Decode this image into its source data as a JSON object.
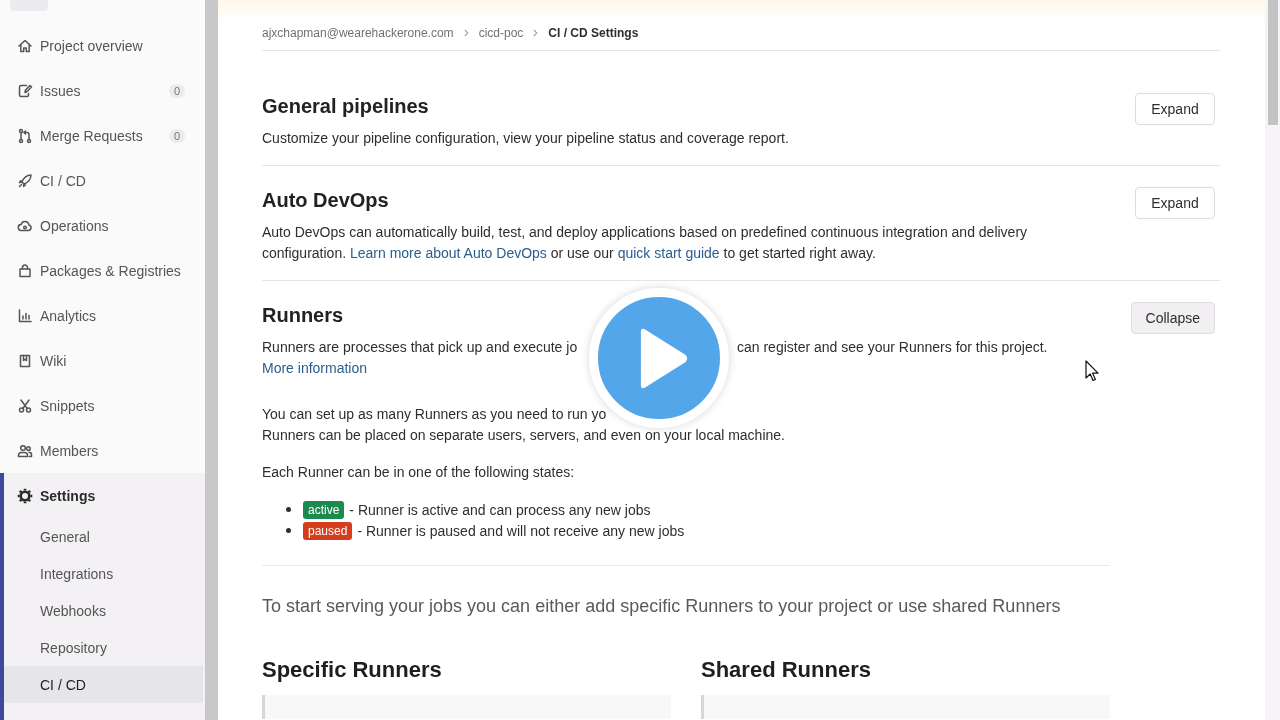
{
  "sidebar": {
    "items": [
      {
        "label": "Project overview",
        "selected": false
      },
      {
        "label": "Issues",
        "count": "0",
        "selected": false
      },
      {
        "label": "Merge Requests",
        "count": "0",
        "selected": false
      },
      {
        "label": "CI / CD",
        "selected": false
      },
      {
        "label": "Operations",
        "selected": false
      },
      {
        "label": "Packages & Registries",
        "selected": false
      },
      {
        "label": "Analytics",
        "selected": false
      },
      {
        "label": "Wiki",
        "selected": false
      },
      {
        "label": "Snippets",
        "selected": false
      },
      {
        "label": "Members",
        "selected": false
      },
      {
        "label": "Settings",
        "selected": true,
        "children": [
          {
            "label": "General",
            "selected": false
          },
          {
            "label": "Integrations",
            "selected": false
          },
          {
            "label": "Webhooks",
            "selected": false
          },
          {
            "label": "Repository",
            "selected": false
          },
          {
            "label": "CI / CD",
            "selected": true
          }
        ]
      }
    ]
  },
  "breadcrumb": [
    {
      "label": "ajxchapman@wearehackerone.com",
      "current": false
    },
    {
      "label": "cicd-poc",
      "current": false
    },
    {
      "label": "CI / CD Settings",
      "current": true
    }
  ],
  "sections": [
    {
      "title": "General pipelines",
      "description": [
        {
          "kind": "text",
          "text": "Customize your pipeline configuration, view your pipeline status and coverage report."
        }
      ],
      "button": "Expand",
      "expanded": false
    },
    {
      "title": "Auto DevOps",
      "description": [
        {
          "kind": "text",
          "text": "Auto DevOps can automatically build, test, and deploy applications based on predefined continuous integration and delivery configuration."
        },
        {
          "kind": "link",
          "text": "Learn more about Auto DevOps"
        },
        {
          "kind": "text",
          "text": "or use our"
        },
        {
          "kind": "link",
          "text": "quick start guide"
        },
        {
          "kind": "text",
          "text": "to get started right away."
        }
      ],
      "button": "Expand",
      "expanded": false
    },
    {
      "title": "Runners",
      "description": [
        {
          "kind": "text",
          "text": "Runners are processes that pick up and execute jo"
        },
        {
          "kind": "covered"
        },
        {
          "kind": "text",
          "text": "can register and see your Runners for this project."
        },
        {
          "kind": "link",
          "text": "More information"
        }
      ],
      "button": "Collapse",
      "expanded": true,
      "body": {
        "setup_lines": [
          "You can set up as many Runners as you need to run yo",
          "Runners can be placed on separate users, servers, and even on your local machine."
        ],
        "states_intro": "Each Runner can be in one of the following states:",
        "states": [
          {
            "badge": "active",
            "color": "#1b8a4f",
            "text": "- Runner is active and can process any new jobs"
          },
          {
            "badge": "paused",
            "color": "#d63c1e",
            "text": "- Runner is paused and will not receive any new jobs"
          }
        ],
        "intro": "To start serving your jobs you can either add specific Runners to your project or use shared Runners",
        "columns": [
          {
            "title": "Specific Runners"
          },
          {
            "title": "Shared Runners"
          }
        ]
      }
    }
  ]
}
